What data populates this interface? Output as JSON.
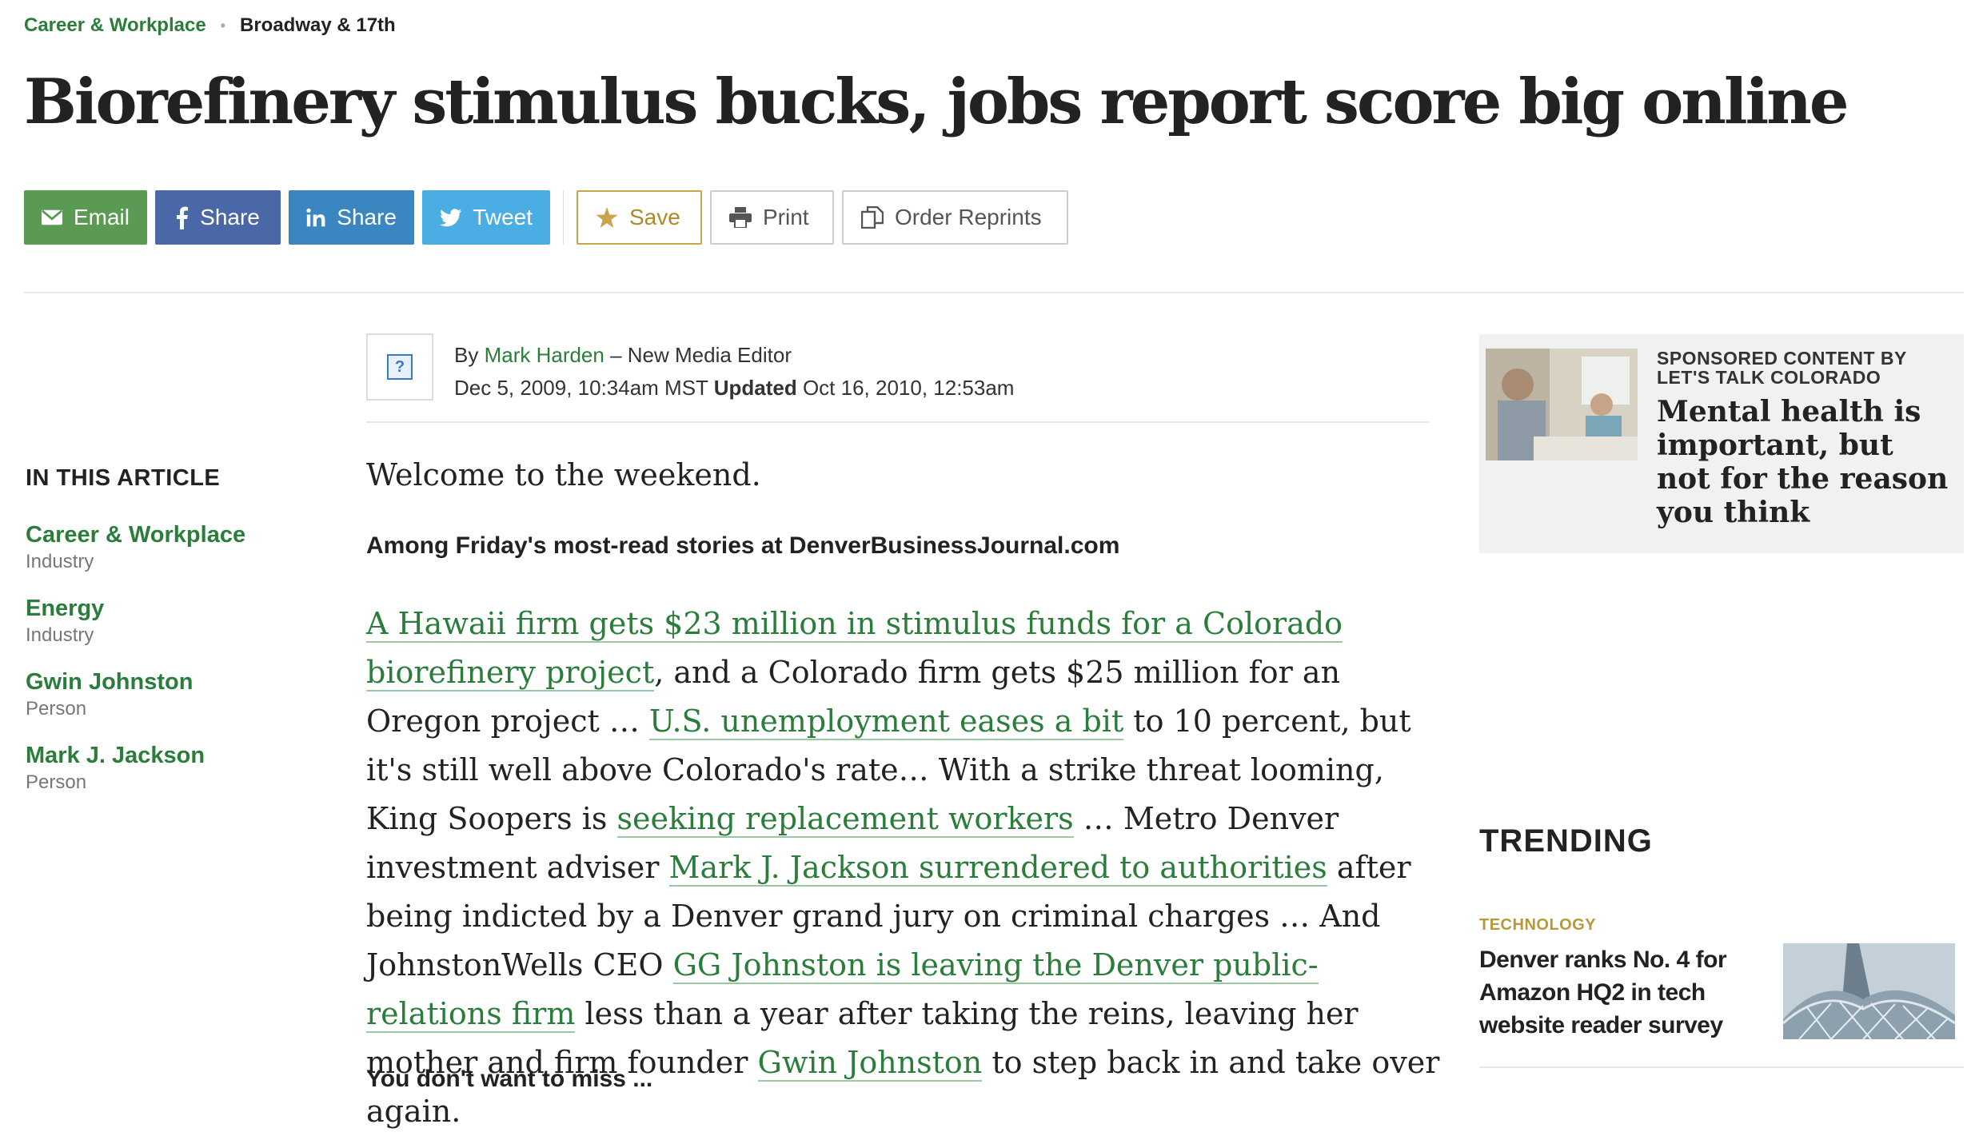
{
  "breadcrumb": {
    "section": "Career & Workplace",
    "column": "Broadway & 17th"
  },
  "headline": "Biorefinery stimulus bucks, jobs report score big online",
  "share": {
    "email": "Email",
    "facebook": "Share",
    "linkedin": "Share",
    "twitter": "Tweet",
    "save": "Save",
    "print": "Print",
    "reprints": "Order Reprints"
  },
  "byline": {
    "by": "By",
    "author": "Mark Harden",
    "role": "– New Media Editor",
    "date": "Dec 5, 2009, 10:34am MST",
    "updated_label": "Updated",
    "updated": "Oct 16, 2010, 12:53am"
  },
  "in_this_article": {
    "title": "IN THIS ARTICLE",
    "items": [
      {
        "name": "Career & Workplace",
        "type": "Industry"
      },
      {
        "name": "Energy",
        "type": "Industry"
      },
      {
        "name": "Gwin Johnston",
        "type": "Person"
      },
      {
        "name": "Mark J. Jackson",
        "type": "Person"
      }
    ]
  },
  "article": {
    "welcome": "Welcome to the weekend.",
    "subhead": "Among Friday's most-read stories at DenverBusinessJournal.com",
    "p": {
      "l1": "A Hawaii firm gets $23 million in stimulus funds for a Colorado biorefinery project",
      "t1": ", and a Colorado firm gets $25 million for an Oregon project … ",
      "l2": "U.S. unemployment eases a bit",
      "t2": " to 10 percent, but it's still well above Colorado's rate… With a strike threat looming, King Soopers is ",
      "l3": "seeking replacement workers",
      "t3": " … Metro Denver investment adviser ",
      "l4": "Mark J. Jackson surrendered to authorities",
      "t4": " after being indicted by a Denver grand jury on criminal charges … And JohnstonWells CEO ",
      "l5": "GG Johnston is leaving the Denver public-relations firm",
      "t5": " less than a year after taking the reins, leaving her mother and firm founder ",
      "l6": "Gwin Johnston",
      "t6": " to step back in and take over again."
    },
    "more": "You don't want to miss ..."
  },
  "sponsored": {
    "label_line1": "SPONSORED CONTENT BY",
    "label_line2": "LET'S TALK COLORADO",
    "title": "Mental health is important, but not for the reason you think"
  },
  "trending": {
    "title": "TRENDING",
    "category": "TECHNOLOGY",
    "headline": "Denver ranks No. 4 for Amazon HQ2 in tech website reader survey"
  }
}
